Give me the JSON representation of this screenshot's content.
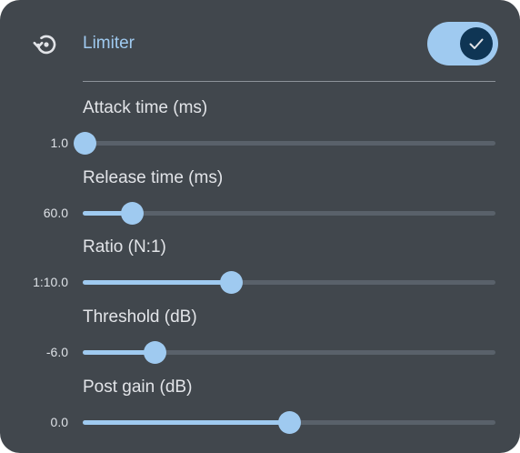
{
  "header": {
    "title": "Limiter",
    "reset_icon": "restore-icon",
    "toggle": {
      "checked": true,
      "check_icon": "check-icon"
    }
  },
  "colors": {
    "background": "#41474d",
    "accent": "#9fcaf0",
    "track": "#59616a",
    "label": "#e2e4e8",
    "toggle_knob": "#0f3554"
  },
  "params": [
    {
      "label": "Attack time (ms)",
      "value": "1.0",
      "position": 0.005
    },
    {
      "label": "Release time (ms)",
      "value": "60.0",
      "position": 0.12
    },
    {
      "label": "Ratio (N:1)",
      "value": "1:10.0",
      "position": 0.36
    },
    {
      "label": "Threshold (dB)",
      "value": "-6.0",
      "position": 0.175
    },
    {
      "label": "Post gain (dB)",
      "value": "0.0",
      "position": 0.5
    }
  ]
}
